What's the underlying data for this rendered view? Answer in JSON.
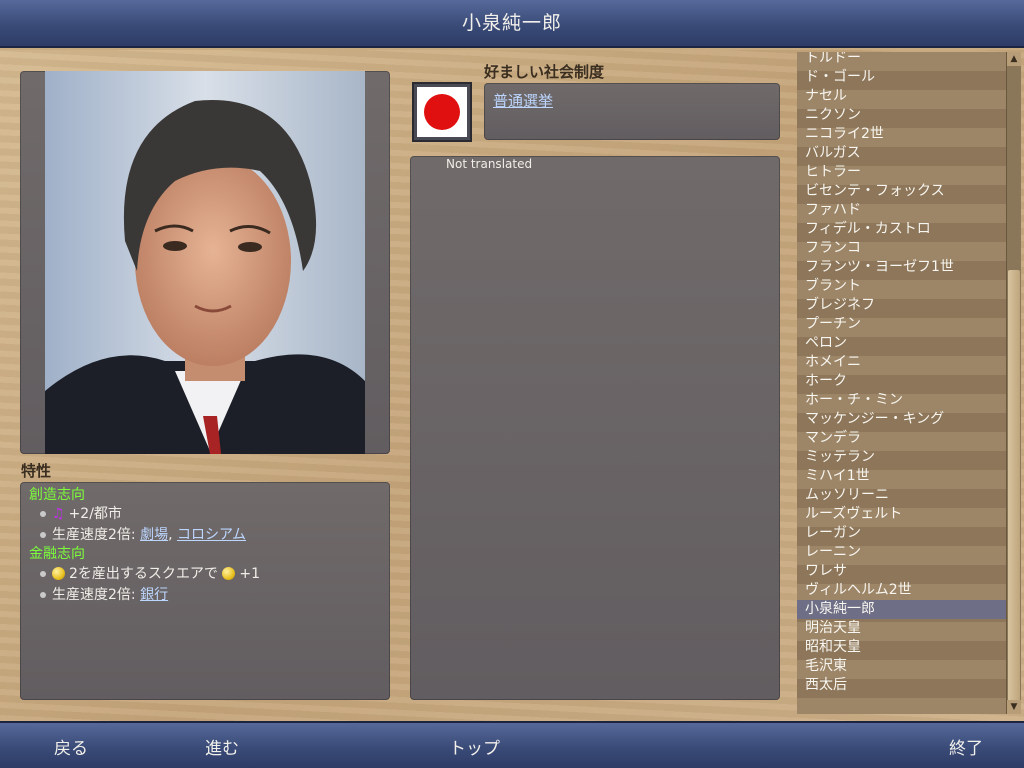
{
  "window": {
    "title": "小泉純一郎"
  },
  "portrait": {
    "alt": ""
  },
  "traits": {
    "heading": "特性",
    "items": [
      {
        "name": "創造志向",
        "lines": [
          {
            "text": "+2/都市"
          },
          {
            "prefix": "生産速度2倍: ",
            "links": [
              "劇場",
              "コロシアム"
            ]
          }
        ]
      },
      {
        "name": "金融志向",
        "lines": [
          {
            "text": "2を産出するスクエアで",
            "suffix": "+1"
          },
          {
            "prefix": "生産速度2倍: ",
            "links": [
              "銀行"
            ]
          }
        ]
      }
    ]
  },
  "civic": {
    "heading": "好ましい社会制度",
    "value": "普通選挙"
  },
  "description": {
    "text": "Not translated"
  },
  "leaders": {
    "items": [
      "トルドー",
      "ド・ゴール",
      "ナセル",
      "ニクソン",
      "ニコライ2世",
      "バルガス",
      "ヒトラー",
      "ビセンテ・フォックス",
      "ファハド",
      "フィデル・カストロ",
      "フランコ",
      "フランツ・ヨーゼフ1世",
      "ブラント",
      "ブレジネフ",
      "プーチン",
      "ペロン",
      "ホメイニ",
      "ホーク",
      "ホー・チ・ミン",
      "マッケンジー・キング",
      "マンデラ",
      "ミッテラン",
      "ミハイ1世",
      "ムッソリーニ",
      "ルーズヴェルト",
      "レーガン",
      "レーニン",
      "ワレサ",
      "ヴィルヘルム2世",
      "小泉純一郎",
      "明治天皇",
      "昭和天皇",
      "毛沢東",
      "西太后"
    ],
    "selected": "小泉純一郎"
  },
  "nav": {
    "back": "戻る",
    "forward": "進む",
    "top": "トップ",
    "exit": "終了"
  },
  "colors": {
    "trait_title": "#7cff3a",
    "link": "#bcd6ff",
    "selected_row": "#6e6f86",
    "bar": "#3a4b78"
  },
  "icons": {
    "culture": "music-note-icon",
    "gold": "gold-coin-icon",
    "flag": "japan-flag-icon"
  }
}
